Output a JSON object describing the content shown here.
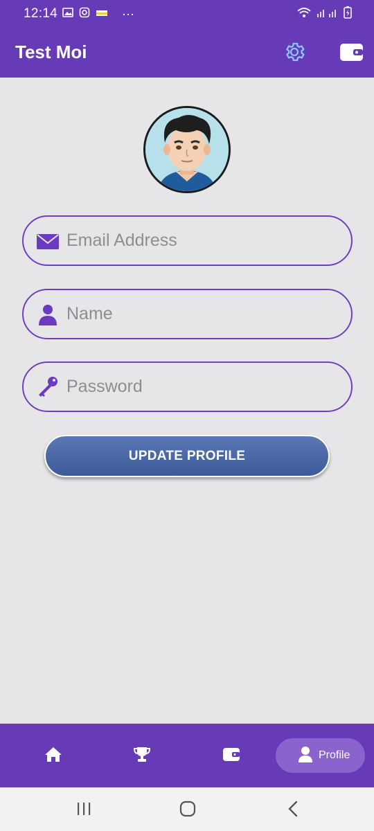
{
  "status_bar": {
    "time": "12:14",
    "more": "···"
  },
  "app_bar": {
    "title": "Test Moi",
    "settings_icon": "gear-icon",
    "wallet_icon": "wallet-icon"
  },
  "profile": {
    "avatar_icon": "avatar"
  },
  "form": {
    "email": {
      "placeholder": "Email Address",
      "value": "",
      "icon": "envelope-icon"
    },
    "name": {
      "placeholder": "Name",
      "value": "",
      "icon": "person-icon"
    },
    "password": {
      "placeholder": "Password",
      "value": "",
      "icon": "key-icon"
    },
    "submit_label": "UPDATE PROFILE"
  },
  "bottom_nav": {
    "items": [
      {
        "id": "home",
        "icon": "home-icon"
      },
      {
        "id": "trophy",
        "icon": "trophy-icon"
      },
      {
        "id": "wallet",
        "icon": "wallet-icon"
      },
      {
        "id": "profile",
        "icon": "person-icon",
        "label": "Profile",
        "active": true
      }
    ]
  },
  "colors": {
    "primary": "#673ab7",
    "field_border": "#6f3fc0",
    "button": "#4a68a8",
    "background": "#e6e6e8"
  }
}
